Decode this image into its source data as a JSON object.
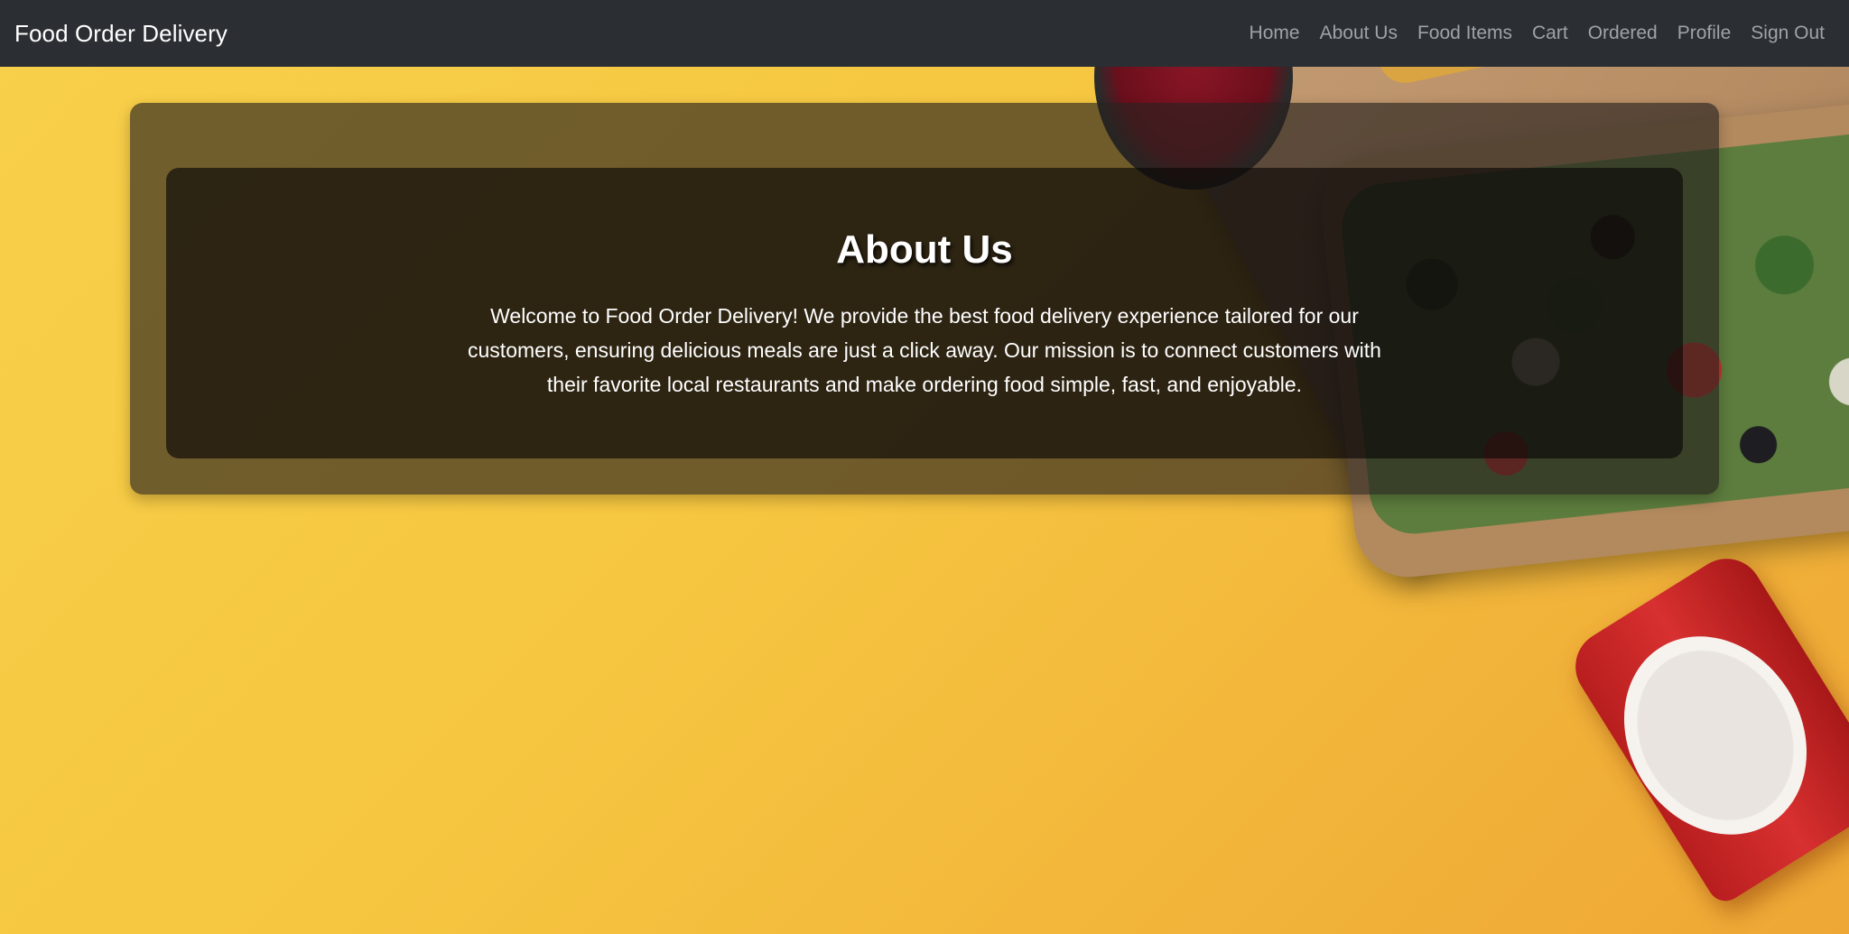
{
  "navbar": {
    "brand": "Food Order Delivery",
    "links": [
      {
        "label": "Home"
      },
      {
        "label": "About Us"
      },
      {
        "label": "Food Items"
      },
      {
        "label": "Cart"
      },
      {
        "label": "Ordered"
      },
      {
        "label": "Profile"
      },
      {
        "label": "Sign Out"
      }
    ]
  },
  "about": {
    "title": "About Us",
    "text": "Welcome to Food Order Delivery! We provide the best food delivery experience tailored for our customers, ensuring delicious meals are just a click away. Our mission is to connect customers with their favorite local restaurants and make ordering food simple, fast, and enjoyable."
  },
  "colors": {
    "navbar_bg": "#2b2f33",
    "nav_link": "#9ea3a8",
    "background_yellow": "#f6c640"
  }
}
